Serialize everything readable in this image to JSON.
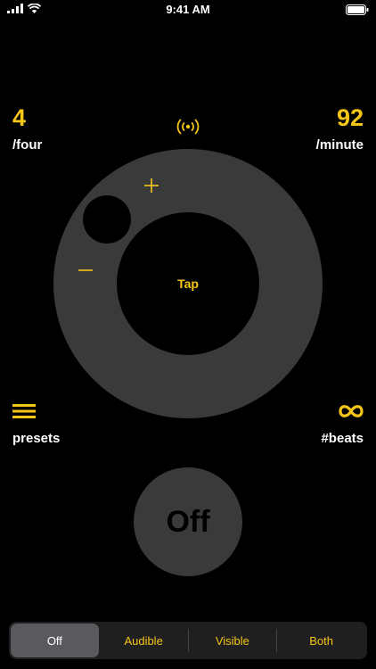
{
  "status_bar": {
    "time": "9:41 AM"
  },
  "meter": {
    "beats_value": "4",
    "beats_label": "/four"
  },
  "tempo": {
    "value": "92",
    "label": "/minute"
  },
  "dial": {
    "center_label": "Tap",
    "increase_icon": "plus-icon",
    "decrease_icon": "minus-icon"
  },
  "presets": {
    "label": "presets",
    "icon": "hamburger-menu-icon"
  },
  "beats": {
    "label": "#beats",
    "icon": "infinity-icon"
  },
  "power_button": {
    "label": "Off"
  },
  "mode_selector": {
    "segments": [
      {
        "label": "Off",
        "selected": true
      },
      {
        "label": "Audible",
        "selected": false
      },
      {
        "label": "Visible",
        "selected": false
      },
      {
        "label": "Both",
        "selected": false
      }
    ]
  },
  "colors": {
    "accent": "#F5C518",
    "dial": "#3a3a3a",
    "background": "#000000"
  }
}
